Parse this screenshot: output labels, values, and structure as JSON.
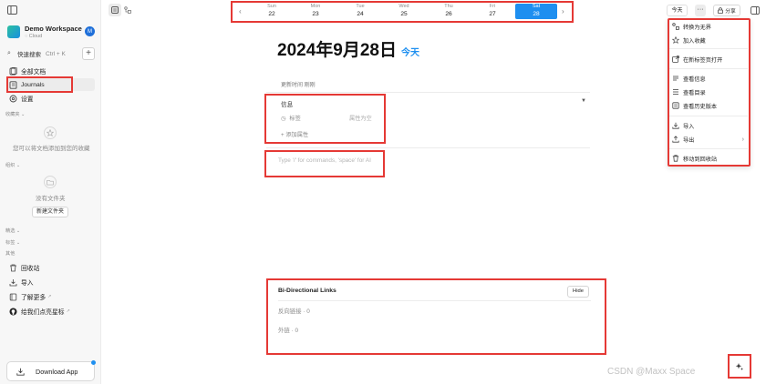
{
  "workspace": {
    "name": "Demo Workspace",
    "sync": "Cloud",
    "avatar_initial": "M"
  },
  "sidebar": {
    "search_label": "快速搜索",
    "search_shortcut": "Ctrl + K",
    "nav": [
      {
        "label": "全部文档",
        "icon": "docs-icon"
      },
      {
        "label": "Journals",
        "icon": "journal-icon"
      },
      {
        "label": "设置",
        "icon": "gear-icon"
      }
    ],
    "favorites_label": "收藏夹",
    "favorites_empty": "您可以将文档添加到您的收藏",
    "org_label": "组织",
    "org_empty": "没有文件夹",
    "new_folder_label": "新建文件夹",
    "picked_label": "精选",
    "tags_label": "标签",
    "other_label": "其他",
    "bottom_nav": [
      {
        "label": "回收站",
        "icon": "trash-icon"
      },
      {
        "label": "导入",
        "icon": "import-icon"
      },
      {
        "label": "了解更多",
        "icon": "book-icon"
      },
      {
        "label": "给我们点亮星标",
        "icon": "github-icon"
      }
    ],
    "download_label": "Download App"
  },
  "weekbar": {
    "days": [
      {
        "name": "Sun",
        "num": "22"
      },
      {
        "name": "Mon",
        "num": "23"
      },
      {
        "name": "Tue",
        "num": "24"
      },
      {
        "name": "Wed",
        "num": "25"
      },
      {
        "name": "Thu",
        "num": "26"
      },
      {
        "name": "Fri",
        "num": "27"
      },
      {
        "name": "Sat",
        "num": "28"
      }
    ],
    "selected_index": 6,
    "prev": "‹",
    "next": "›"
  },
  "toolbar": {
    "today_label": "今天",
    "more_label": "···",
    "share_label": "分享"
  },
  "page": {
    "title": "2024年9月28日",
    "today_link": "今天",
    "updated": "更新时间 刚刚",
    "info_title": "信息",
    "tag_label": "标签",
    "tag_empty": "属性为空",
    "add_property": "添加属性",
    "editor_placeholder": "Type '/' for commands, 'space' for AI"
  },
  "bilinks": {
    "title": "Bi-Directional Links",
    "hide_label": "Hide",
    "backlinks": "反向链接 · 0",
    "outlinks": "外链 · 0"
  },
  "menu": {
    "items": [
      {
        "label": "转换为无界",
        "icon": "edgeless-icon"
      },
      {
        "label": "加入收藏",
        "icon": "star-icon"
      },
      {
        "label": "在新标签页打开",
        "icon": "open-tab-icon"
      },
      {
        "label": "查看信息",
        "icon": "info-icon"
      },
      {
        "label": "查看目录",
        "icon": "toc-icon"
      },
      {
        "label": "查看历史版本",
        "icon": "history-icon"
      },
      {
        "label": "导入",
        "icon": "import-icon"
      },
      {
        "label": "导出",
        "icon": "export-icon"
      },
      {
        "label": "移动到回收站",
        "icon": "trash-icon"
      }
    ]
  },
  "watermark": "CSDN @Maxx Space",
  "colors": {
    "accent": "#1e8ff0",
    "highlight": "#e53935",
    "avatar": "#1e6fd9"
  }
}
